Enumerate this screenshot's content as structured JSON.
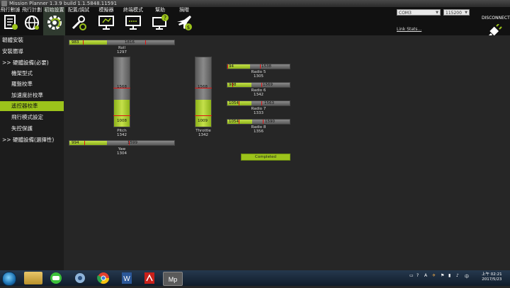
{
  "window": {
    "title": "Mission Planner 1.3.9 build 1.1.5848.11591"
  },
  "toolbar": {
    "items": [
      {
        "label": "飛行數據",
        "icon": "flight-data-icon"
      },
      {
        "label": "飛行計劃",
        "icon": "flight-plan-icon"
      },
      {
        "label": "初始設置",
        "icon": "initial-setup-icon"
      },
      {
        "label": "配置/調試",
        "icon": "config-tuning-icon"
      },
      {
        "label": "模擬器",
        "icon": "simulation-icon"
      },
      {
        "label": "終端模式",
        "icon": "terminal-icon"
      },
      {
        "label": "幫助",
        "icon": "help-icon"
      },
      {
        "label": "捐贈",
        "icon": "donate-icon"
      }
    ],
    "port_value": "COM3",
    "baud_value": "115200",
    "link_stats": "Link Stats...",
    "disconnect": "DISCONNECT"
  },
  "sidebar": {
    "items": [
      {
        "label": "韌體安裝"
      },
      {
        "label": "安裝嚮導"
      },
      {
        "label": ">> 硬體設備(必要)"
      },
      {
        "label": "機架型式"
      },
      {
        "label": "羅盤校準"
      },
      {
        "label": "加速度計校準"
      },
      {
        "label": "遙控器校準"
      },
      {
        "label": "飛行模式設定"
      },
      {
        "label": "失控保護"
      },
      {
        "label": ">> 硬體設備(選擇性)"
      }
    ],
    "active_index": 6
  },
  "calibration": {
    "roll": {
      "name": "Roll",
      "value": "1297",
      "min": "983",
      "max": "1816",
      "value_num": 1297,
      "min_num": 983,
      "max_num": 1816
    },
    "yaw": {
      "name": "Yaw",
      "value": "1304",
      "min": "994",
      "max": "1599",
      "value_num": 1304,
      "min_num": 994,
      "max_num": 1599
    },
    "pitch": {
      "name": "Pitch",
      "value": "1342",
      "min": "1008",
      "max": "1568",
      "value_num": 1342,
      "min_num": 1008,
      "max_num": 1568
    },
    "throttle": {
      "name": "Throttle",
      "value": "1342",
      "min": "1009",
      "max": "1568",
      "value_num": 1342,
      "min_num": 1009,
      "max_num": 1568
    },
    "radios": [
      {
        "name": "Radio 5",
        "value": "1305",
        "min": "94",
        "max": "1538",
        "value_num": 1305,
        "min_num": 94,
        "max_num": 1538
      },
      {
        "name": "Radio 6",
        "value": "1342",
        "min": "908",
        "max": "1569",
        "value_num": 1342,
        "min_num": 908,
        "max_num": 1569
      },
      {
        "name": "Radio 7",
        "value": "1333",
        "min": "1054",
        "max": "1563",
        "value_num": 1333,
        "min_num": 1054,
        "max_num": 1563
      },
      {
        "name": "Radio 8",
        "value": "1356",
        "min": "1054",
        "max": "1590",
        "value_num": 1356,
        "min_num": 1054,
        "max_num": 1590
      }
    ],
    "complete_label": "Completed",
    "range_lo": 800,
    "range_hi": 2200
  },
  "taskbar": {
    "apps": [
      "file-explorer-icon",
      "line-icon",
      "media-icon",
      "chrome-icon",
      "word-icon",
      "pdf-icon",
      "mission-planner-icon"
    ],
    "ime": "A",
    "time": "上午 02:21",
    "date": "2017/5/23"
  },
  "colors": {
    "accent": "#9cc31b",
    "marker": "#e01010"
  }
}
